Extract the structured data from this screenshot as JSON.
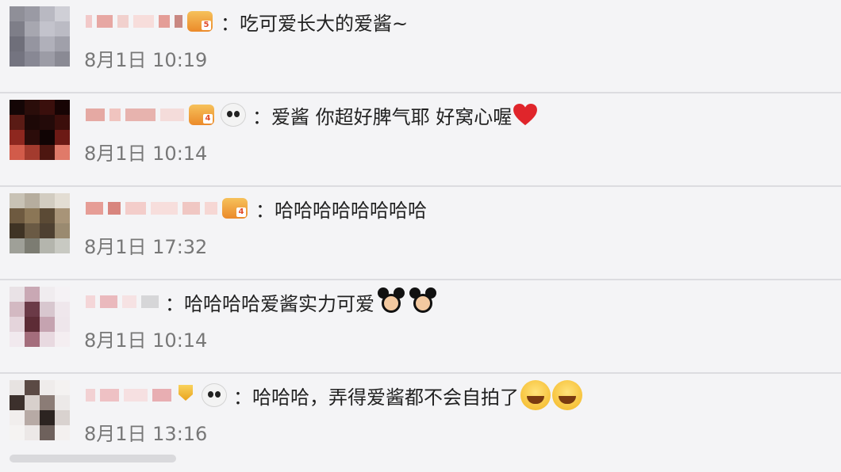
{
  "comments": [
    {
      "text": "：吃可爱长大的爱酱~",
      "time": "8月1日 10:19",
      "badge_level": "5",
      "emoji": []
    },
    {
      "text": "：爱酱 你超好脾气耶 好窝心喔",
      "time": "8月1日 10:14",
      "badge_level": "4",
      "emoji": [
        "heart"
      ]
    },
    {
      "text": "：哈哈哈哈哈哈哈哈",
      "time": "8月1日 17:32",
      "badge_level": "4",
      "emoji": []
    },
    {
      "text": "：哈哈哈哈爱酱实力可爱",
      "time": "8月1日 10:14",
      "emoji": [
        "mickey",
        "mickey"
      ]
    },
    {
      "text": "：哈哈哈，弄得爱酱都不会自拍了",
      "time": "8月1日 13:16",
      "emoji": [
        "laugh",
        "laugh"
      ]
    }
  ],
  "colors": {
    "background": "#f4f4f6",
    "divider": "#dcdce0",
    "time_text": "#777777",
    "badge_orange": "#eb8a2a",
    "heart_red": "#e0252b"
  },
  "icons": [
    "level-badge-icon",
    "panda-icon",
    "vip-badge-icon",
    "heart-emoji-icon",
    "mickey-emoji-icon",
    "laughing-tears-emoji-icon"
  ]
}
